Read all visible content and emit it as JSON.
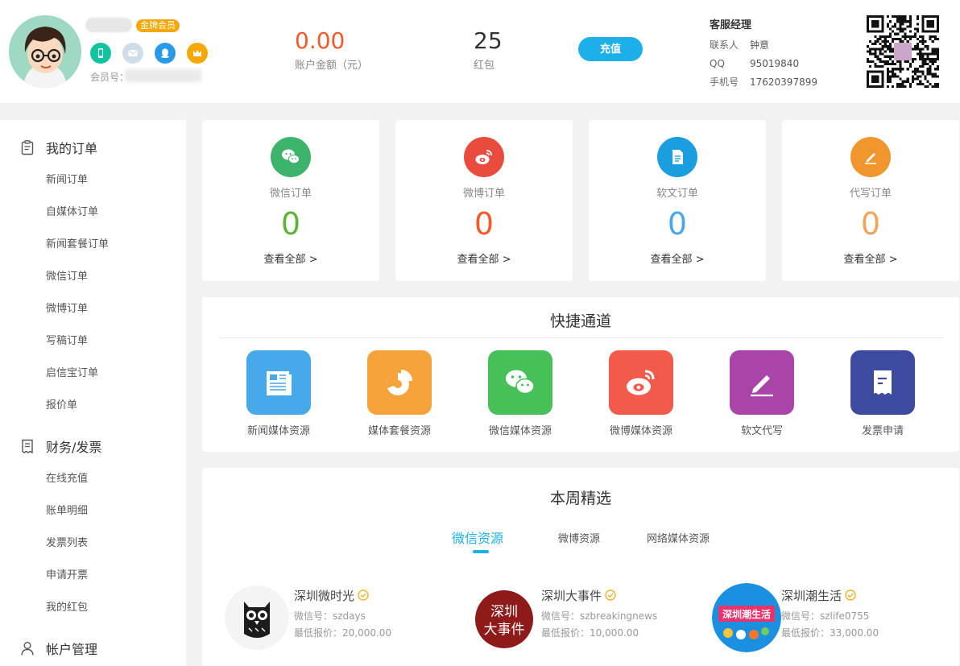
{
  "header": {
    "member_badge": "金牌会员",
    "member_no_label": "会员号：",
    "balance": {
      "value": "0.00",
      "label": "账户金额（元）"
    },
    "redpack": {
      "value": "25",
      "label": "红包"
    },
    "recharge_label": "充值",
    "service": {
      "title": "客服经理",
      "rows": [
        {
          "k": "联系人",
          "v": "钟意"
        },
        {
          "k": "QQ",
          "v": "95019840"
        },
        {
          "k": "手机号",
          "v": "17620397899"
        }
      ]
    }
  },
  "sidebar": {
    "groups": [
      {
        "title": "我的订单",
        "icon": "clipboard-icon",
        "items": [
          "新闻订单",
          "自媒体订单",
          "新闻套餐订单",
          "微信订单",
          "微博订单",
          "写稿订单",
          "启信宝订单",
          "报价单"
        ]
      },
      {
        "title": "财务/发票",
        "icon": "receipt-icon",
        "items": [
          "在线充值",
          "账单明细",
          "发票列表",
          "申请开票",
          "我的红包"
        ]
      },
      {
        "title": "帐户管理",
        "icon": "user-icon",
        "items": []
      }
    ]
  },
  "orders": [
    {
      "name": "微信订单",
      "count": "0",
      "more": "查看全部 >",
      "color": "#3db36b",
      "count_color": "#5cb531",
      "icon": "wechat-icon"
    },
    {
      "name": "微博订单",
      "count": "0",
      "more": "查看全部 >",
      "color": "#e94c3d",
      "count_color": "#f25a2a",
      "icon": "weibo-icon"
    },
    {
      "name": "软文订单",
      "count": "0",
      "more": "查看全部 >",
      "color": "#1a9ee0",
      "count_color": "#4aa7e8",
      "icon": "document-icon"
    },
    {
      "name": "代写订单",
      "count": "0",
      "more": "查看全部 >",
      "color": "#f0962c",
      "count_color": "#f3a45a",
      "icon": "pencil-icon"
    }
  ],
  "quick": {
    "title": "快捷通道",
    "items": [
      {
        "label": "新闻媒体资源",
        "color": "#48a9ea",
        "icon": "newspaper-icon"
      },
      {
        "label": "媒体套餐资源",
        "color": "#f6a23a",
        "icon": "pie-chart-icon"
      },
      {
        "label": "微信媒体资源",
        "color": "#47c05a",
        "icon": "wechat-icon"
      },
      {
        "label": "微博媒体资源",
        "color": "#f25a4c",
        "icon": "weibo-icon"
      },
      {
        "label": "软文代写",
        "color": "#a945a8",
        "icon": "pencil-icon"
      },
      {
        "label": "发票申请",
        "color": "#3c4aa0",
        "icon": "invoice-icon"
      }
    ]
  },
  "weekly": {
    "title": "本周精选",
    "tabs": [
      "微信资源",
      "微博资源",
      "网络媒体资源"
    ],
    "items": [
      {
        "name": "深圳微时光",
        "id": "微信号：szdays",
        "price": "最低报价：20,000.00",
        "logo": "owl-logo"
      },
      {
        "name": "深圳大事件",
        "id": "微信号：szbreakingnews",
        "price": "最低报价：10,000.00",
        "logo": "red-seal-logo",
        "logo_text": [
          "深圳",
          "大事件"
        ]
      },
      {
        "name": "深圳潮生活",
        "id": "微信号：szlife0755",
        "price": "最低报价：33,000.00",
        "logo": "blue-circle-logo",
        "logo_text": [
          "深圳潮生活"
        ]
      }
    ]
  }
}
